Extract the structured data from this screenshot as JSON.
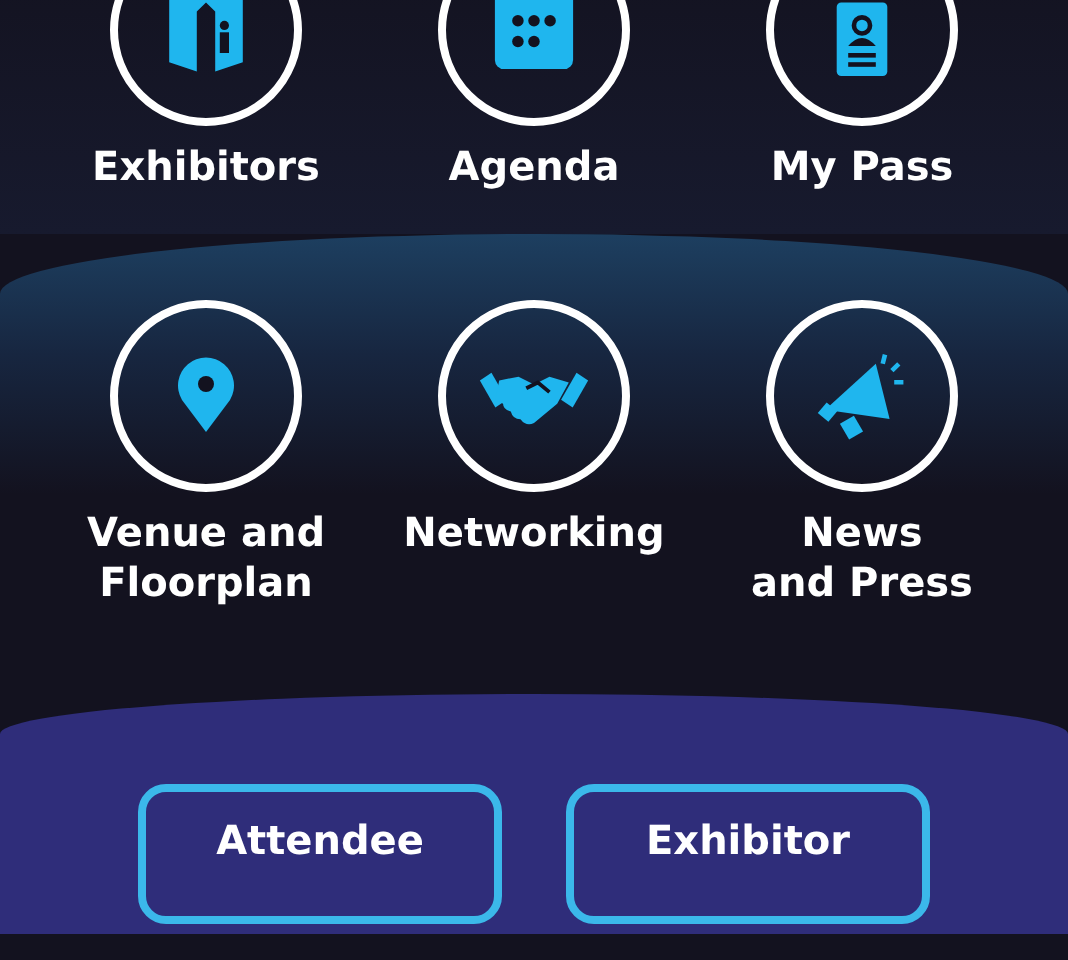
{
  "top_tiles": [
    {
      "kind": "exhibitors",
      "lines": [
        "Exhibitors"
      ]
    },
    {
      "kind": "agenda",
      "lines": [
        "Agenda"
      ]
    },
    {
      "kind": "pass",
      "lines": [
        "My Pass"
      ]
    }
  ],
  "middle_tiles": [
    {
      "kind": "venue",
      "lines": [
        "Venue and",
        "Floorplan"
      ]
    },
    {
      "kind": "networking",
      "lines": [
        "Networking"
      ]
    },
    {
      "kind": "news",
      "lines": [
        "News",
        "and Press"
      ]
    }
  ],
  "buttons": [
    "Attendee",
    "Exhibitor"
  ]
}
